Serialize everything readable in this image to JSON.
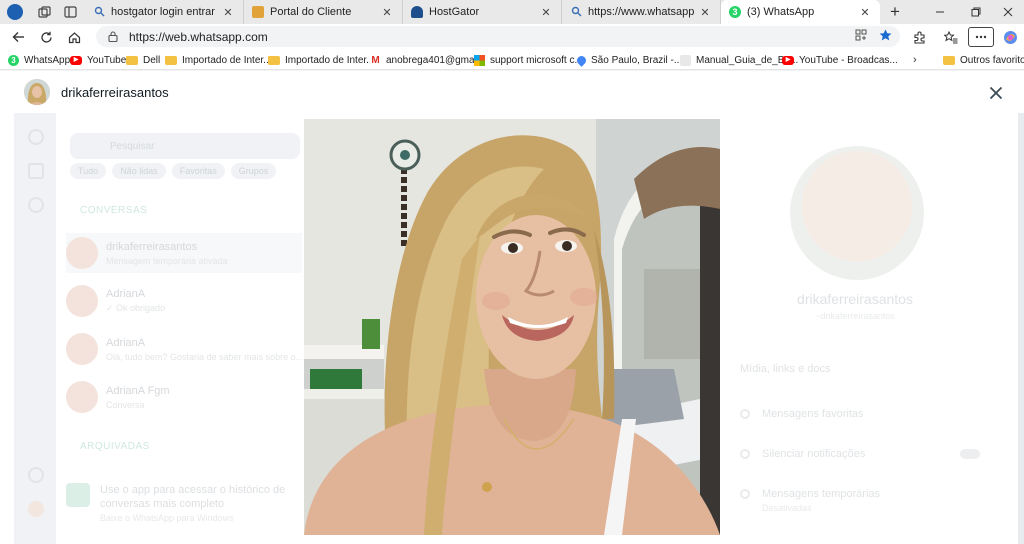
{
  "browser": {
    "tabs": [
      {
        "title": "hostgator login entrar - Pesquisar",
        "favicon": "search-icon",
        "close_label": "✕"
      },
      {
        "title": "Portal do Cliente",
        "favicon": "portal-icon",
        "close_label": "✕"
      },
      {
        "title": "HostGator",
        "favicon": "hostgator-icon",
        "close_label": "✕"
      },
      {
        "title": "https://www.whatsapp web - Pes",
        "favicon": "search-icon",
        "close_label": "✕"
      },
      {
        "title": "(3) WhatsApp",
        "favicon": "whatsapp-icon",
        "close_label": "✕",
        "active": true
      }
    ],
    "new_tab_label": "+",
    "address": {
      "url": "https://web.whatsapp.com"
    },
    "bookmarks": [
      {
        "label": "WhatsApp",
        "icon": "whatsapp-icon"
      },
      {
        "label": "YouTube",
        "icon": "youtube-icon"
      },
      {
        "label": "Dell",
        "icon": "folder-icon"
      },
      {
        "label": "Importado de Inter...",
        "icon": "folder-icon"
      },
      {
        "label": "Importado de Inter...",
        "icon": "folder-icon"
      },
      {
        "label": "anobrega401@gma...",
        "icon": "gmail-icon"
      },
      {
        "label": "support microsoft c...",
        "icon": "microsoft-icon"
      },
      {
        "label": "São Paulo, Brazil -...",
        "icon": "maps-icon"
      },
      {
        "label": "Manual_Guia_de_Bo...",
        "icon": "document-icon"
      },
      {
        "label": "YouTube - Broadcas...",
        "icon": "youtube-icon"
      }
    ],
    "other_favorites": "Outros favoritos"
  },
  "viewer": {
    "contact_name": "drikaferreirasantos"
  },
  "background_app": {
    "search_placeholder": "Pesquisar",
    "chips": [
      "Tudo",
      "Não lidas",
      "Favoritas",
      "Grupos"
    ],
    "section_chats": "CONVERSAS",
    "chats": [
      {
        "name": "drikaferreirasantos",
        "preview": "Mensagem temporária ativada"
      },
      {
        "name": "AdrianA",
        "preview": "✓ Ok obrigado"
      },
      {
        "name": "AdrianA",
        "preview": "Olá, tudo bem? Gostaria de saber mais sobre o..."
      },
      {
        "name": "AdrianA Fgm",
        "preview": "Conversa"
      }
    ],
    "section_archived": "ARQUIVADAS",
    "notice_text": "Use o app para acessar o histórico de conversas mais completo",
    "notice_link": "Baixe o WhatsApp para Windows",
    "profile_name": "drikaferreirasantos",
    "profile_sub": "~drikaferreirasantos",
    "profile_rows": [
      "Mídia, links e docs",
      "Mensagens favoritas",
      "Silenciar notificações",
      "Mensagens temporárias"
    ],
    "profile_row_sub": "Desativadas"
  },
  "colors": {
    "whatsapp_green": "#25d366",
    "accent_blue": "#1b6bd1",
    "header_text": "#111b21"
  }
}
